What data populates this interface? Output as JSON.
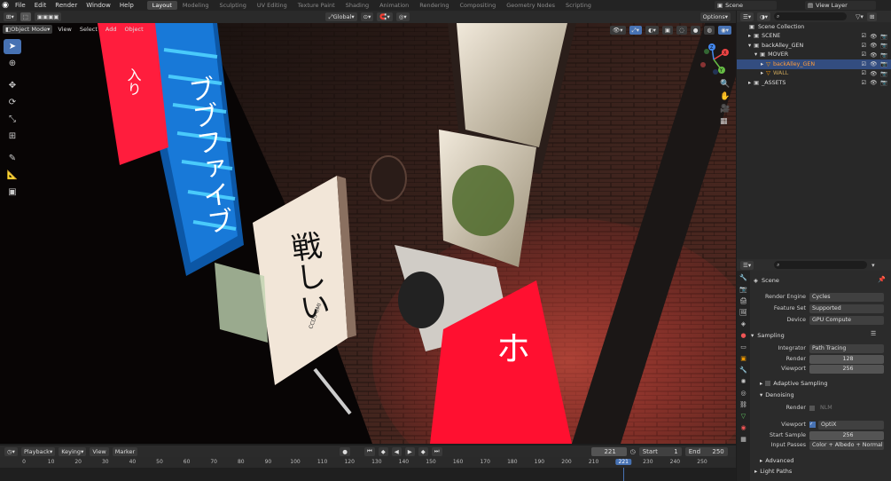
{
  "menu": [
    "File",
    "Edit",
    "Render",
    "Window",
    "Help"
  ],
  "workspaces": [
    "Layout",
    "Modeling",
    "Sculpting",
    "UV Editing",
    "Texture Paint",
    "Shading",
    "Animation",
    "Rendering",
    "Compositing",
    "Geometry Nodes",
    "Scripting"
  ],
  "scene_name": "Scene",
  "view_layer": "View Layer",
  "header": {
    "transform": "Global",
    "options": "Options"
  },
  "viewport": {
    "mode": "Object Mode",
    "menus": [
      "View",
      "Select",
      "Add",
      "Object"
    ],
    "gizmo": {
      "x": "X",
      "y": "Y",
      "z": "Z"
    },
    "signs": {
      "blue_sign": "ブブファイブ",
      "white_sign": "戦しい",
      "white_small": "CCD3 OMI",
      "red_top": "入り",
      "red_bottom": "ホ"
    }
  },
  "outliner": {
    "collection": "Scene Collection",
    "items": [
      {
        "label": "SCENE",
        "depth": 1,
        "expand": "▸"
      },
      {
        "label": "backAlley_GEN",
        "depth": 1,
        "expand": "▾"
      },
      {
        "label": "MOVER",
        "depth": 2,
        "expand": "▾"
      },
      {
        "label": "backAlley_GEN",
        "depth": 3,
        "expand": "▸"
      },
      {
        "label": "WALL",
        "depth": 3,
        "expand": "▸"
      },
      {
        "label": "_ASSETS",
        "depth": 1,
        "expand": "▸"
      }
    ]
  },
  "properties": {
    "scene_label": "Scene",
    "render_engine": {
      "label": "Render Engine",
      "value": "Cycles"
    },
    "feature_set": {
      "label": "Feature Set",
      "value": "Supported"
    },
    "device": {
      "label": "Device",
      "value": "GPU Compute"
    },
    "sampling": "Sampling",
    "integrator": {
      "label": "Integrator",
      "value": "Path Tracing"
    },
    "render": {
      "label": "Render",
      "value": "128"
    },
    "viewport": {
      "label": "Viewport",
      "value": "256"
    },
    "adaptive": "Adaptive Sampling",
    "denoising": "Denoising",
    "den_render": {
      "label": "Render",
      "value": "NLM"
    },
    "den_viewport": {
      "label": "Viewport",
      "value": "OptiX"
    },
    "start_sample": {
      "label": "Start Sample",
      "value": "256"
    },
    "input_passes": {
      "label": "Input Passes",
      "value": "Color + Albedo + Normal"
    },
    "advanced": "Advanced",
    "light_paths": "Light Paths"
  },
  "timeline": {
    "menus": [
      "Playback",
      "Keying",
      "View",
      "Marker"
    ],
    "current": "221",
    "start_label": "Start",
    "start": "1",
    "end_label": "End",
    "end": "250",
    "ticks": [
      "0",
      "10",
      "20",
      "30",
      "40",
      "50",
      "60",
      "70",
      "80",
      "90",
      "100",
      "110",
      "120",
      "130",
      "140",
      "150",
      "160",
      "170",
      "180",
      "190",
      "200",
      "210",
      "221",
      "230",
      "240",
      "250"
    ]
  },
  "colors": {
    "accent": "#4772b3",
    "selection": "#334d80",
    "frame": "#4772b3"
  }
}
